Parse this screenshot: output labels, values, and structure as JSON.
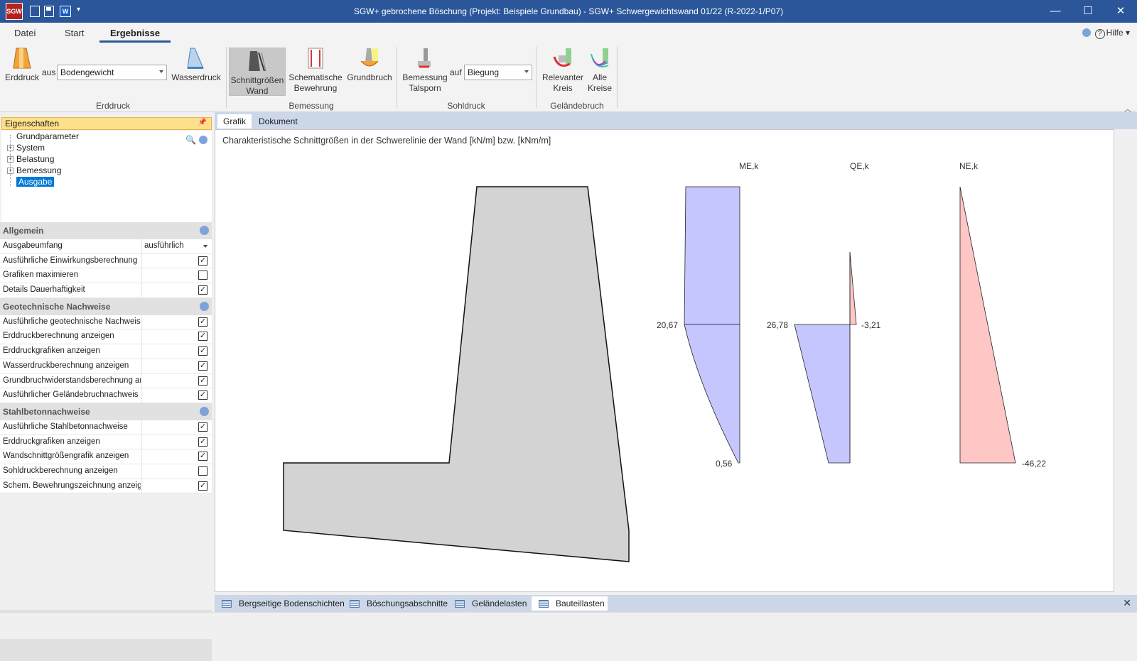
{
  "window": {
    "title": "SGW+ gebrochene Böschung (Projekt: Beispiele Grundbau) - SGW+ Schwergewichtswand 01/22 (R-2022-1/P07)",
    "app_icon_text": "SGW",
    "word_icon_text": "W"
  },
  "ribbon_tabs": [
    {
      "label": "Datei"
    },
    {
      "label": "Start"
    },
    {
      "label": "Ergebnisse",
      "active": true
    }
  ],
  "help_label": "Hilfe",
  "ribbon": {
    "erddruck_btn": "Erddruck",
    "aus_label": "aus",
    "aus_combo": "Bodengewicht",
    "wasserdruck_btn": "Wasserdruck",
    "group_erddruck": "Erddruck",
    "schnittgroessen_btn": [
      "Schnittgrößen",
      "Wand"
    ],
    "schem_bewehrung_btn": [
      "Schematische",
      "Bewehrung"
    ],
    "grundbruch_btn": "Grundbruch",
    "group_bemessung": "Bemessung",
    "bemessung_talsporn_btn": [
      "Bemessung",
      "Talsporn"
    ],
    "auf_label": "auf",
    "auf_combo": "Biegung",
    "group_sohldruck": "Sohldruck",
    "relevanter_kreis_btn": [
      "Relevanter",
      "Kreis"
    ],
    "alle_kreise_btn": [
      "Alle",
      "Kreise"
    ],
    "group_gelaendebruch": "Geländebruch"
  },
  "left_panel": {
    "header": "Eigenschaften",
    "tree": [
      {
        "label": "Grundparameter",
        "expandable": false
      },
      {
        "label": "System",
        "expandable": true
      },
      {
        "label": "Belastung",
        "expandable": true
      },
      {
        "label": "Bemessung",
        "expandable": true
      },
      {
        "label": "Ausgabe",
        "expandable": false,
        "selected": true
      }
    ],
    "categories": [
      {
        "name": "Allgemein",
        "rows": [
          {
            "label": "Ausgabeumfang",
            "value": "ausführlich",
            "type": "dropdown"
          },
          {
            "label": "Ausführliche Einwirkungsberechnung",
            "checked": true
          },
          {
            "label": "Grafiken maximieren",
            "checked": false
          },
          {
            "label": "Details Dauerhaftigkeit",
            "checked": true
          }
        ]
      },
      {
        "name": "Geotechnische Nachweise",
        "rows": [
          {
            "label": "Ausführliche geotechnische Nachweise",
            "checked": true
          },
          {
            "label": "Erddruckberechnung anzeigen",
            "checked": true
          },
          {
            "label": "Erddruckgrafiken anzeigen",
            "checked": true
          },
          {
            "label": "Wasserdruckberechnung anzeigen",
            "checked": true
          },
          {
            "label": "Grundbruchwiderstandsberechnung anzeigen",
            "checked": true
          },
          {
            "label": "Ausführlicher Geländebruchnachweis",
            "checked": true
          }
        ]
      },
      {
        "name": "Stahlbetonnachweise",
        "rows": [
          {
            "label": "Ausführliche Stahlbetonnachweise",
            "checked": true
          },
          {
            "label": "Erddruckgrafiken anzeigen",
            "checked": true
          },
          {
            "label": "Wandschnittgrößengrafik anzeigen",
            "checked": true
          },
          {
            "label": "Sohldruckberechnung anzeigen",
            "checked": false
          },
          {
            "label": "Schem. Bewehrungszeichnung anzeigen",
            "checked": true
          }
        ]
      }
    ]
  },
  "doc_tabs": [
    {
      "label": "Grafik",
      "active": true
    },
    {
      "label": "Dokument"
    }
  ],
  "canvas": {
    "title": "Charakteristische Schnittgrößen in der Schwerelinie der Wand [kN/m] bzw. [kNm/m]",
    "diagrams": {
      "me": {
        "label": "ME,k",
        "mid_value": "20,67",
        "bottom_value": "0,56"
      },
      "qe": {
        "label": "QE,k",
        "left_value": "26,78",
        "right_value": "-3,21"
      },
      "ne": {
        "label": "NE,k",
        "bottom_value": "-46,22"
      }
    },
    "colors": {
      "positive": "#c6c6ff",
      "negative": "#ffc6c6",
      "wall": "#d3d3d3"
    }
  },
  "bottom_tabs": [
    {
      "label": "Bergseitige Bodenschichten"
    },
    {
      "label": "Böschungsabschnitte"
    },
    {
      "label": "Geländelasten"
    },
    {
      "label": "Bauteillasten",
      "active": true
    }
  ]
}
